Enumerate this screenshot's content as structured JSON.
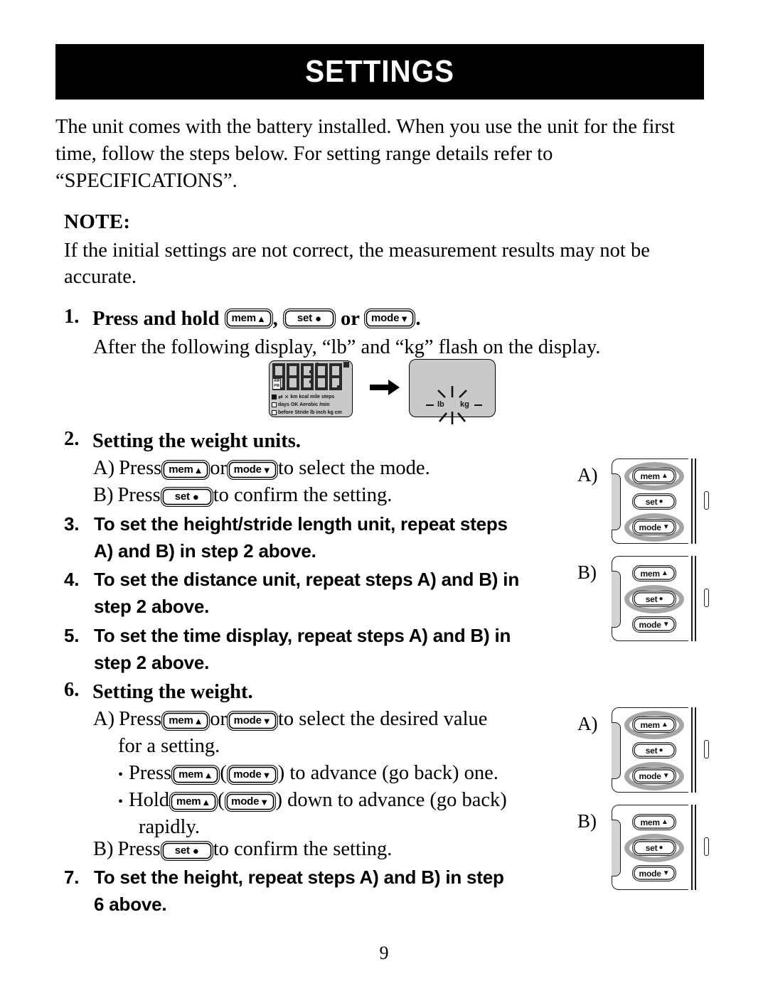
{
  "header": {
    "title": "SETTINGS"
  },
  "intro": {
    "paragraph": "The unit comes with the battery installed. When you use the unit for the first time, follow the steps below. For setting range details refer to “SPECIFICATIONS”."
  },
  "note": {
    "label": "NOTE:",
    "text": "If the initial settings are not correct, the measurement results may not be accurate."
  },
  "keys": {
    "mem": "mem",
    "set": "set",
    "mode": "mode",
    "tri_up": "▲",
    "tri_down": "▼",
    "dot": "●"
  },
  "steps": {
    "s1": {
      "num": "1.",
      "title_pre": "Press and hold ",
      "sep_comma": ", ",
      "sep_or": " or ",
      "title_end": ".",
      "detail": "After the following display, “lb” and “kg” flash on the display."
    },
    "s2": {
      "num": "2.",
      "title": "Setting the weight units.",
      "a_label": "A)",
      "a_pre": "Press ",
      "a_mid": " or ",
      "a_post": " to select the mode.",
      "b_label": "B)",
      "b_pre": "Press ",
      "b_post": " to confirm the setting."
    },
    "s3": {
      "num": "3.",
      "line1": "To set the height/stride length unit, repeat steps",
      "line2": "A) and B) in step 2 above."
    },
    "s4": {
      "num": "4.",
      "line1": "To set the distance unit, repeat steps A) and B) in",
      "line2": "step 2 above."
    },
    "s5": {
      "num": "5.",
      "line1": "To set the time display, repeat steps A) and B) in",
      "line2": "step 2 above."
    },
    "s6": {
      "num": "6.",
      "title": "Setting the weight.",
      "a_label": "A)",
      "a_pre": "Press ",
      "a_mid": " or ",
      "a_post": " to select the desired value",
      "a_line2": "for a setting.",
      "bullet1_pre": "Press ",
      "bullet1_open": " (",
      "bullet1_close": ") to advance (go back) one.",
      "bullet2_pre": "Hold ",
      "bullet2_open": " (",
      "bullet2_close": ") down to advance (go back)",
      "bullet2_line2": "rapidly.",
      "b_label": "B)",
      "b_pre": "Press ",
      "b_post": " to confirm the setting.",
      "bullet_char": "•"
    },
    "s7": {
      "num": "7.",
      "line1": "To set the height, repeat steps A) and B) in step",
      "line2": "6 above."
    }
  },
  "lcd": {
    "digits": "88:88.8",
    "ampm": "AM\nPM",
    "indicator_rows": [
      {
        "icons": [
          "battery",
          "arrows",
          "shoe"
        ],
        "labels": "km kcal mile steps"
      },
      {
        "icons": [
          "box"
        ],
        "labels": "days  OK  Aerobic    /min"
      },
      {
        "icons": [
          "box"
        ],
        "labels": "before Stride lb inch kg cm"
      }
    ],
    "row1_labels": [
      "km",
      "kcal",
      "mile",
      "steps"
    ],
    "row2_labels": [
      "days",
      "OK",
      "Aerobic",
      "/min"
    ],
    "row3_labels": [
      "before",
      "Stride",
      "lb",
      "inch",
      "kg",
      "cm"
    ],
    "flash_lb": "lb",
    "flash_kg": "kg",
    "arrow": "➡"
  },
  "devices": [
    {
      "letter": "A)",
      "buttons": [
        {
          "label": "mem",
          "glyph": "▲",
          "highlighted": true
        },
        {
          "label": "set",
          "glyph": "●",
          "highlighted": false
        },
        {
          "label": "mode",
          "glyph": "▼",
          "highlighted": true
        }
      ]
    },
    {
      "letter": "B)",
      "buttons": [
        {
          "label": "mem",
          "glyph": "▲",
          "highlighted": false
        },
        {
          "label": "set",
          "glyph": "●",
          "highlighted": true
        },
        {
          "label": "mode",
          "glyph": "▼",
          "highlighted": false
        }
      ]
    },
    {
      "letter": "A)",
      "buttons": [
        {
          "label": "mem",
          "glyph": "▲",
          "highlighted": true
        },
        {
          "label": "set",
          "glyph": "●",
          "highlighted": false
        },
        {
          "label": "mode",
          "glyph": "▼",
          "highlighted": true
        }
      ]
    },
    {
      "letter": "B)",
      "buttons": [
        {
          "label": "mem",
          "glyph": "▲",
          "highlighted": false
        },
        {
          "label": "set",
          "glyph": "●",
          "highlighted": true
        },
        {
          "label": "mode",
          "glyph": "▼",
          "highlighted": false
        }
      ]
    }
  ],
  "footer": {
    "page_number": "9"
  },
  "colors": {
    "header_bg": "#000000",
    "header_text": "#ffffff",
    "lcd_bg": "#c9c9c9",
    "highlight_ring": "#a6a6a6"
  }
}
